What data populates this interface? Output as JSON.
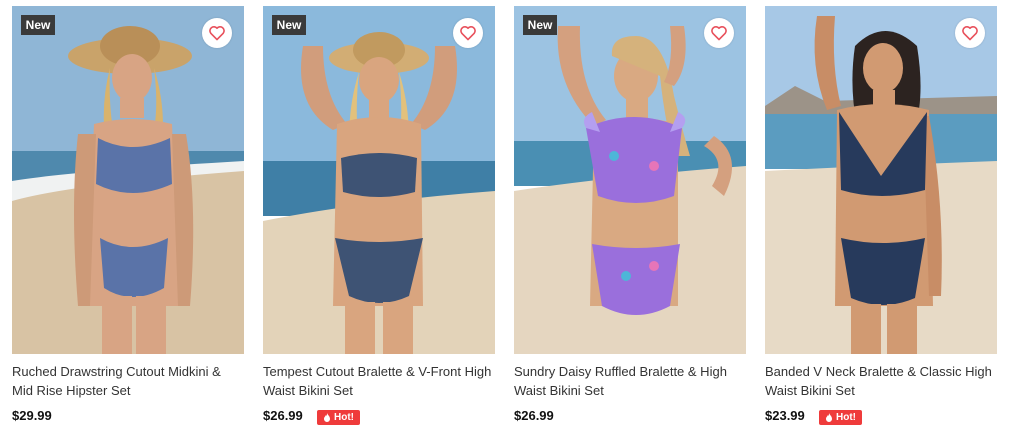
{
  "products": [
    {
      "badge": "New",
      "title": "Ruched Drawstring Cutout Midkini & Mid Rise Hipster Set",
      "price": "$29.99",
      "hot": null,
      "swimsuit_color": "#5a73a8"
    },
    {
      "badge": "New",
      "title": "Tempest Cutout Bralette & V-Front High Waist Bikini Set",
      "price": "$26.99",
      "hot": "Hot!",
      "swimsuit_color": "#3e5374"
    },
    {
      "badge": "New",
      "title": "Sundry Daisy Ruffled Bralette & High Waist Bikini Set",
      "price": "$26.99",
      "hot": null,
      "swimsuit_color": "#9a6fdc"
    },
    {
      "badge": null,
      "title": "Banded V Neck Bralette & Classic High Waist Bikini Set",
      "price": "$23.99",
      "hot": "Hot!",
      "swimsuit_color": "#273a5c"
    }
  ],
  "icons": {
    "wishlist": "heart-outline-icon",
    "hot": "flame-icon"
  },
  "colors": {
    "wishlist_heart": "#e8505b",
    "hot_badge": "#ef3b3b",
    "new_badge": "#3a3a3a"
  }
}
